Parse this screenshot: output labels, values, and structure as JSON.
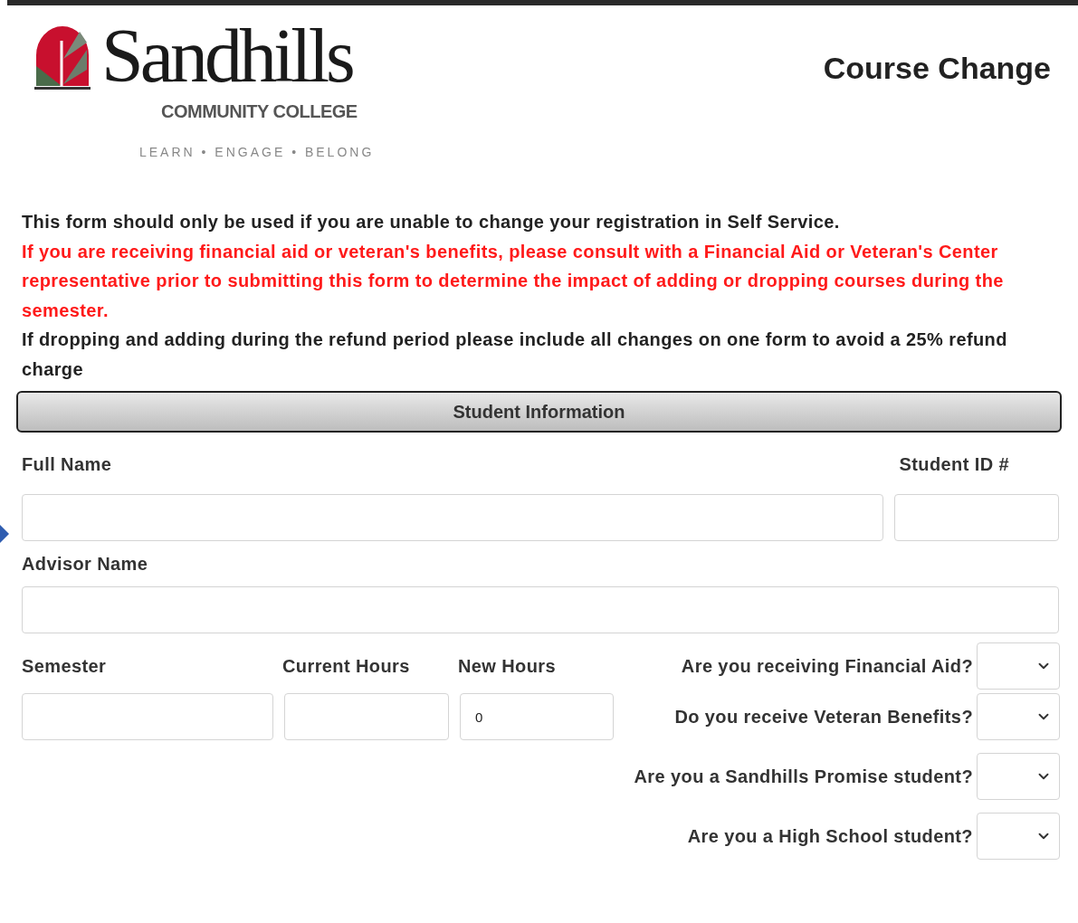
{
  "logo": {
    "name": "Sandhills",
    "subtitle": "COMMUNITY COLLEGE",
    "tagline": "LEARN • ENGAGE • BELONG"
  },
  "title": "Course Change",
  "notices": [
    {
      "text": "This form should only be used if you are unable to change your registration in Self Service.",
      "kind": "normal"
    },
    {
      "text": "If you are receiving financial aid or veteran's benefits, please consult with a Financial Aid or Veteran's Center representative prior to submitting this form to determine the impact of adding or dropping courses during the semester.",
      "kind": "warning"
    },
    {
      "text": "If dropping and adding during the refund period please include all changes on one form to avoid a 25% refund charge",
      "kind": "normal"
    }
  ],
  "section": {
    "title": "Student Information"
  },
  "fields": {
    "full_name": {
      "label": "Full Name"
    },
    "student_id": {
      "label": "Student ID #"
    },
    "advisor": {
      "label": "Advisor Name"
    },
    "semester": {
      "label": "Semester"
    },
    "current_hours": {
      "label": "Current Hours"
    },
    "new_hours": {
      "label": "New Hours",
      "value": "0"
    }
  },
  "questions": [
    {
      "label": "Are you receiving Financial Aid?"
    },
    {
      "label": "Do you receive Veteran Benefits?"
    },
    {
      "label": "Are you a Sandhills Promise student?"
    },
    {
      "label": "Are you a High School student?"
    }
  ]
}
